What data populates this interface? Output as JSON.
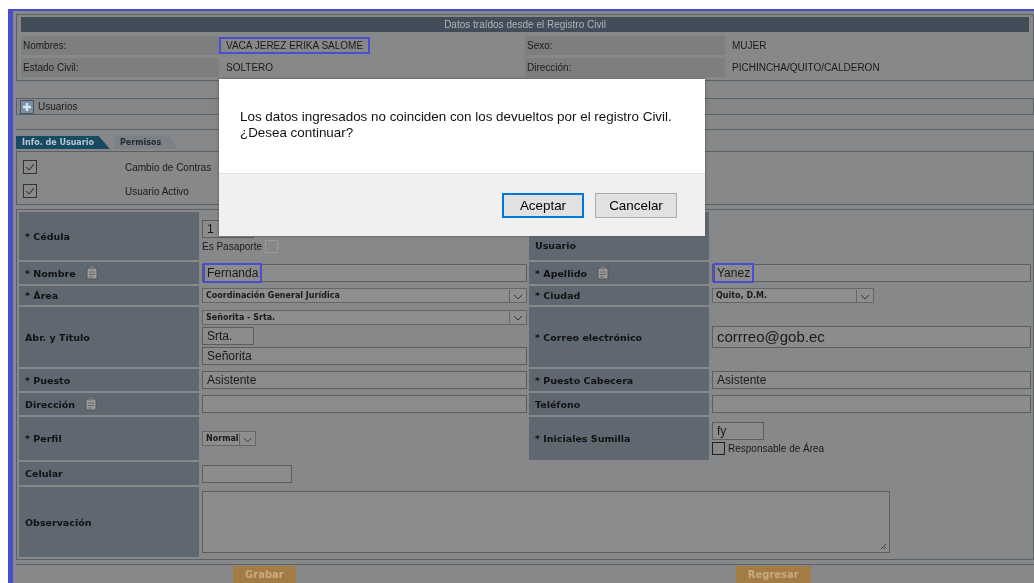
{
  "registro": {
    "title": "Datos traídos desde el Registro Civil",
    "fields": [
      {
        "label": "Nombres:",
        "value": "VACA JEREZ ERIKA SALOME",
        "highlighted": true
      },
      {
        "label": "Sexo:",
        "value": "MUJER",
        "highlighted": false
      },
      {
        "label": "Estado Civil:",
        "value": "SOLTERO",
        "highlighted": false
      },
      {
        "label": "Dirección:",
        "value": "PICHINCHA/QUITO/CALDERON",
        "highlighted": false
      }
    ]
  },
  "section": {
    "title": "Usuarios"
  },
  "tabs": [
    {
      "label": "Info. de Usuario",
      "selected": true
    },
    {
      "label": "Permisos",
      "selected": false
    }
  ],
  "checks": [
    {
      "label": "Cambio de Contras",
      "checked": true
    },
    {
      "label": "Usuario Activo",
      "checked": true
    }
  ],
  "form": {
    "rows": [
      {
        "left": {
          "label": "* Cédula",
          "controls": [
            {
              "kind": "short_text",
              "value": "1"
            },
            {
              "kind": "checkbox",
              "label": "Es Pasaporte",
              "checked": false
            }
          ]
        },
        "right": {
          "label": "Usuario"
        }
      },
      {
        "left": {
          "label": "* Nombre",
          "clip": true,
          "controls": [
            {
              "kind": "text",
              "value": "Fernanda",
              "highlighted": true
            }
          ]
        },
        "right": {
          "label": "* Apellido",
          "clip": true,
          "controls": [
            {
              "kind": "text",
              "value": "Yanez",
              "highlighted": true
            }
          ]
        }
      },
      {
        "left": {
          "label": "* Área",
          "controls": [
            {
              "kind": "select",
              "value": "Coordinación General Jurídica"
            }
          ]
        },
        "right": {
          "label": "* Ciudad",
          "controls": [
            {
              "kind": "short_select",
              "value": "Quito, D.M."
            }
          ]
        }
      },
      {
        "left": {
          "label": "Abr. y Título",
          "controls": [
            {
              "kind": "select",
              "value": "Señorita - Srta."
            },
            {
              "kind": "short_text",
              "value": "Srta."
            },
            {
              "kind": "text",
              "value": "Señorita"
            }
          ]
        },
        "right": {
          "label": "* Correo electrónico",
          "controls": [
            {
              "kind": "large_text",
              "value": "corrreo@gob.ec"
            }
          ]
        }
      },
      {
        "left": {
          "label": "* Puesto",
          "controls": [
            {
              "kind": "text",
              "value": "Asistente"
            }
          ]
        },
        "right": {
          "label": "* Puesto Cabecera",
          "controls": [
            {
              "kind": "text",
              "value": "Asistente"
            }
          ]
        }
      },
      {
        "left": {
          "label": "Dirección",
          "clip": true,
          "controls": [
            {
              "kind": "text"
            }
          ]
        },
        "right": {
          "label": "Teléfono",
          "controls": [
            {
              "kind": "text"
            }
          ]
        }
      },
      {
        "left": {
          "label": "* Perfil",
          "controls": [
            {
              "kind": "tiny_select",
              "value": "Normal"
            }
          ]
        },
        "right": {
          "label": "* Iniciales Sumilla",
          "controls": [
            {
              "kind": "short_text",
              "value": "fy"
            },
            {
              "kind": "checkbox",
              "label": "Responsable de Área",
              "checked": false
            }
          ]
        }
      },
      {
        "left": {
          "label": "Celular",
          "controls": [
            {
              "kind": "medium_text"
            }
          ]
        }
      },
      {
        "left": {
          "label": "Observación",
          "controls": [
            {
              "kind": "textarea"
            }
          ]
        }
      }
    ]
  },
  "buttons": [
    "Grabar",
    "Regresar"
  ],
  "dialog": {
    "message": "Los datos ingresados no coinciden con los devueltos por el registro Civil. ¿Desea continuar?",
    "buttons": [
      {
        "label": "Aceptar",
        "selected": true
      },
      {
        "label": "Cancelar",
        "selected": false
      }
    ]
  }
}
